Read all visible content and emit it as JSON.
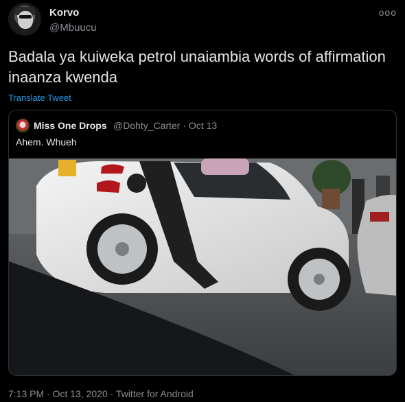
{
  "author": {
    "display_name": "Korvo",
    "handle": "@Mbuucu"
  },
  "tweet": {
    "text": "Badala ya kuiweka petrol unaiambia words of affirmation inaanza kwenda",
    "translate_label": "Translate Tweet",
    "timestamp": "7:13 PM · Oct 13, 2020 · Twitter for Android"
  },
  "quoted_tweet": {
    "display_name": "Miss One Drops",
    "handle": "@Dohty_Carter",
    "date": "Oct 13",
    "meta": "@Dohty_Carter · Oct 13",
    "text": "Ahem. Whueh"
  },
  "icons": {
    "more": "more-icon",
    "photo": "car-photo"
  },
  "colors": {
    "background": "#000000",
    "link": "#1d9bf0",
    "secondary_text": "#8a8f94",
    "border": "#2f3336"
  }
}
